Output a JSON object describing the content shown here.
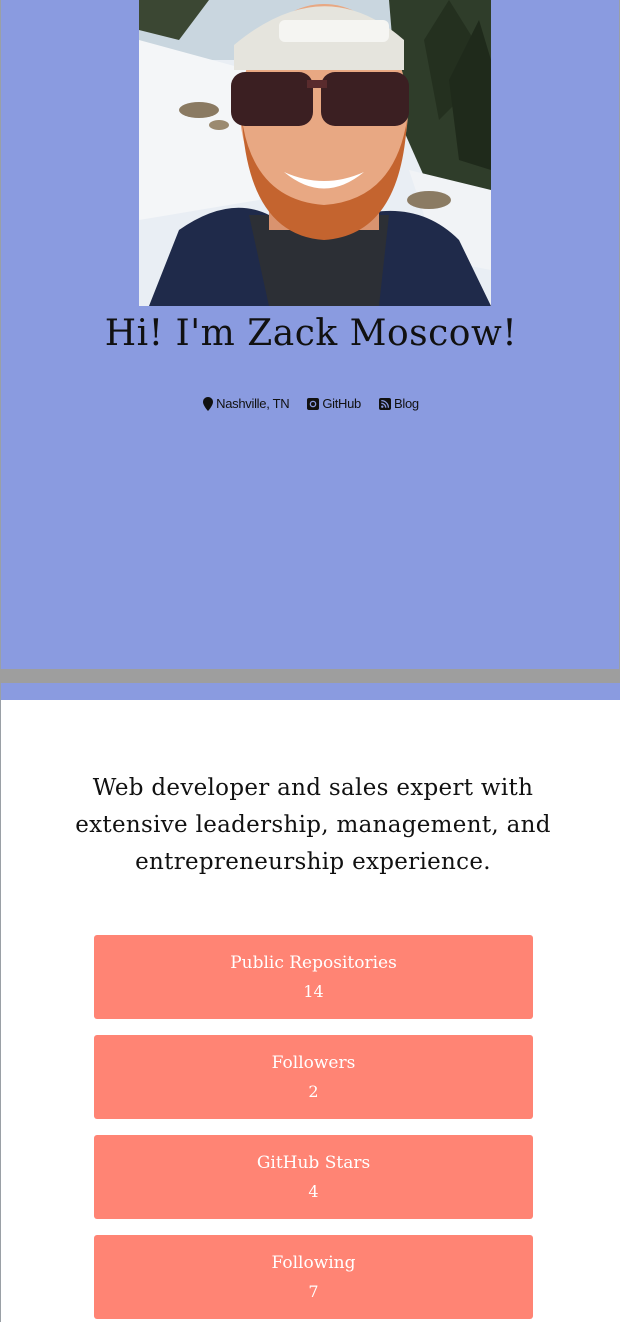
{
  "profile": {
    "name_heading": "Hi! I'm Zack Moscow!",
    "photo_alt": "Zack Moscow",
    "links": [
      {
        "icon": "map-pin-icon",
        "label": "Nashville, TN"
      },
      {
        "icon": "github-icon",
        "label": "GitHub"
      },
      {
        "icon": "rss-icon",
        "label": "Blog"
      }
    ]
  },
  "about": {
    "tagline": "Web developer and sales expert with extensive leadership, management, and entrepreneurship experience."
  },
  "stats": [
    {
      "label": "Public Repositories",
      "value": "14"
    },
    {
      "label": "Followers",
      "value": "2"
    },
    {
      "label": "GitHub Stars",
      "value": "4"
    },
    {
      "label": "Following",
      "value": "7"
    }
  ],
  "colors": {
    "hero_bg": "#8a9be0",
    "stat_bg": "#ff8474",
    "divider": "#9e9e9e"
  }
}
